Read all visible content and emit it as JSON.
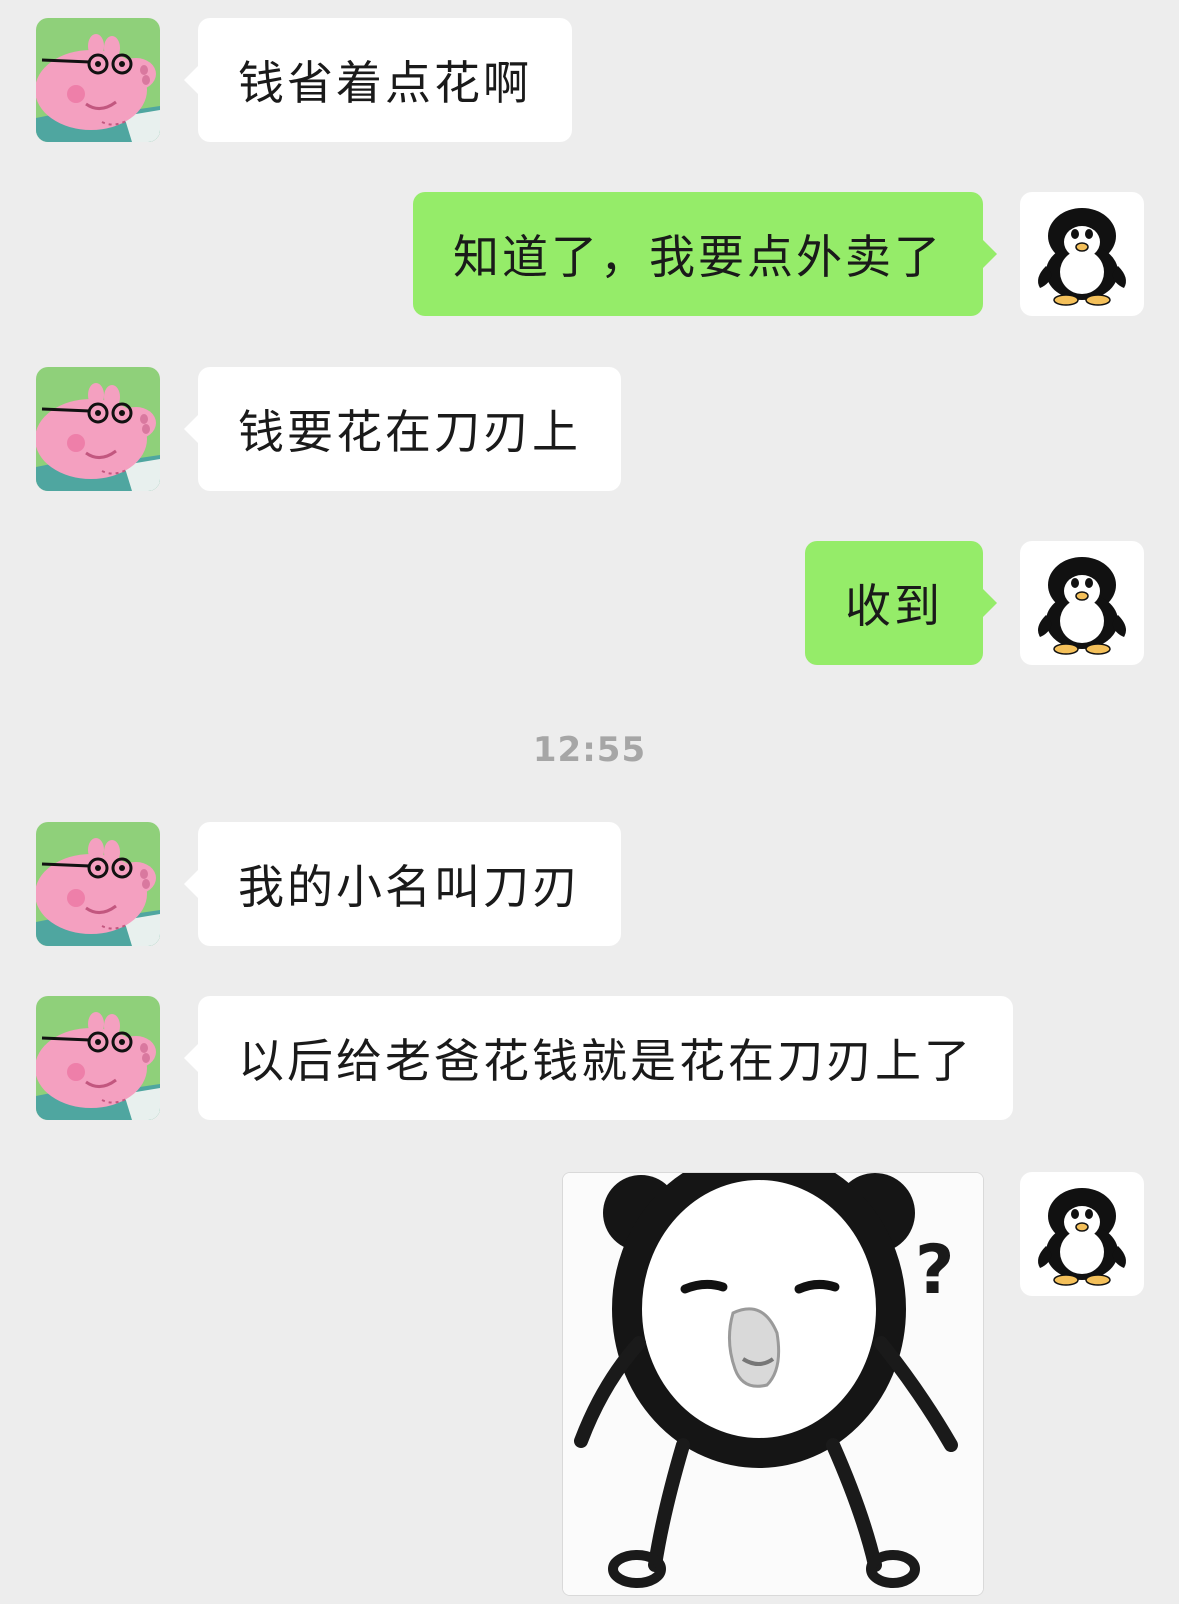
{
  "chat": {
    "messages": [
      {
        "side": "incoming",
        "text": "钱省着点花啊"
      },
      {
        "side": "outgoing",
        "text": "知道了，我要点外卖了"
      },
      {
        "side": "incoming",
        "text": "钱要花在刀刃上"
      },
      {
        "side": "outgoing",
        "text": "收到"
      },
      {
        "side": "incoming",
        "text": "我的小名叫刀刃"
      },
      {
        "side": "incoming",
        "text": "以后给老爸花钱就是花在刀刃上了"
      },
      {
        "side": "outgoing",
        "type": "sticker",
        "text": "?"
      }
    ],
    "timestamp": "12:55"
  },
  "avatars": {
    "incoming_icon": "pig-dad-avatar-icon",
    "outgoing_icon": "penguin-avatar-icon"
  },
  "colors": {
    "background": "#ededed",
    "incoming_bubble": "#ffffff",
    "outgoing_bubble": "#95ec69",
    "timestamp": "#a6a6a6"
  }
}
